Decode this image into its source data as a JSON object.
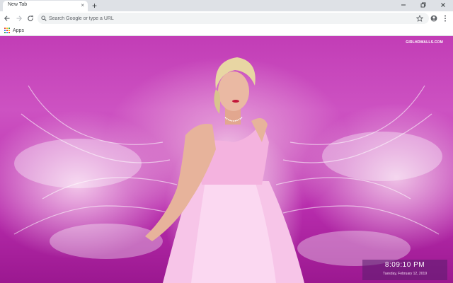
{
  "tab": {
    "title": "New Tab",
    "close_glyph": "×"
  },
  "tabstrip": {
    "new_tab_glyph": "+"
  },
  "window": {
    "minimize_icon": "minimize-icon",
    "restore_icon": "restore-icon",
    "close_icon": "close-icon"
  },
  "toolbar": {
    "back_icon": "arrow-left-icon",
    "forward_icon": "arrow-right-icon",
    "reload_icon": "reload-icon",
    "omnibox_placeholder": "Search Google or type a URL",
    "omnibox_value": "",
    "bookmark_star_icon": "star-icon",
    "profile_icon": "account-icon",
    "menu_icon": "kebab-menu-icon"
  },
  "bookmarks": {
    "apps_label": "Apps",
    "apps_icon_colors": [
      "#ea4335",
      "#fbbc05",
      "#34a853",
      "#4285f4",
      "#ea4335",
      "#fbbc05",
      "#34a853",
      "#4285f4",
      "#ea4335"
    ]
  },
  "wallpaper": {
    "brand": "GIRLHDWALLS.COM",
    "accent_color": "#c23db6"
  },
  "clock": {
    "time": "8:09:10 PM",
    "date": "Tuesday, February 12, 2019"
  }
}
